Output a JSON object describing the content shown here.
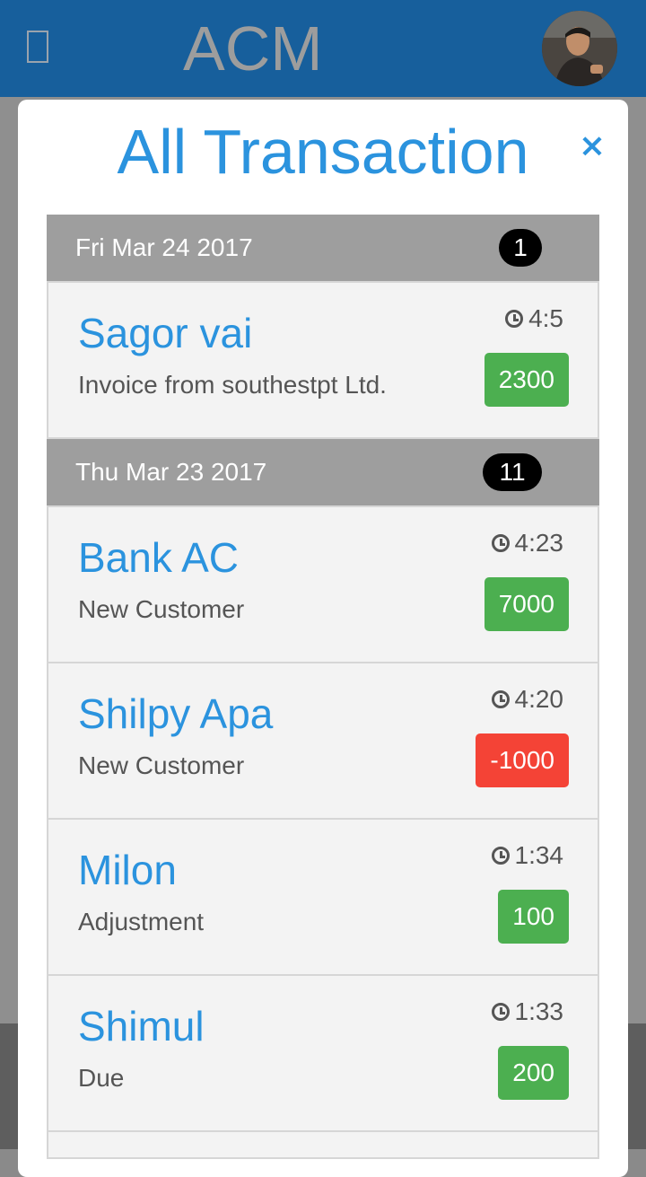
{
  "app": {
    "title": "ACM"
  },
  "modal": {
    "title": "All Transaction",
    "close_symbol": "×"
  },
  "days": [
    {
      "date": "Fri Mar 24 2017",
      "count": "1",
      "transactions": [
        {
          "name": "Sagor vai",
          "description": "Invoice from southestpt Ltd.",
          "time": "4:5",
          "amount": "2300",
          "type": "positive"
        }
      ]
    },
    {
      "date": "Thu Mar 23 2017",
      "count": "11",
      "transactions": [
        {
          "name": "Bank AC",
          "description": "New Customer",
          "time": "4:23",
          "amount": "7000",
          "type": "positive"
        },
        {
          "name": "Shilpy Apa",
          "description": "New Customer",
          "time": "4:20",
          "amount": "-1000",
          "type": "negative"
        },
        {
          "name": "Milon",
          "description": "Adjustment",
          "time": "1:34",
          "amount": "100",
          "type": "positive"
        },
        {
          "name": "Shimul",
          "description": "Due",
          "time": "1:33",
          "amount": "200",
          "type": "positive"
        }
      ]
    }
  ],
  "colors": {
    "appbar": "#175f9c",
    "accent": "#2b93de",
    "positive": "#4caf50",
    "negative": "#f44336"
  }
}
